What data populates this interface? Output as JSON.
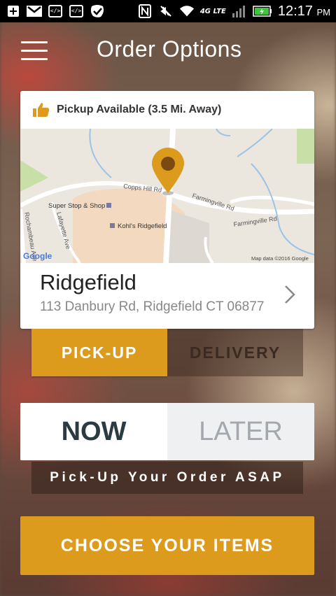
{
  "status_bar": {
    "time": "12:17",
    "ampm": "PM",
    "network": "4G LTE",
    "icons": [
      "plus-icon",
      "gmail-icon",
      "code-icon",
      "code-icon",
      "check-icon",
      "nfc-icon",
      "mute-icon",
      "wifi-icon",
      "signal-icon",
      "battery-icon"
    ]
  },
  "header": {
    "title": "Order Options"
  },
  "location_card": {
    "availability": "Pickup Available (3.5 Mi. Away)",
    "map": {
      "labels": {
        "road1": "Copps Hill Rd",
        "road2": "Farmingville Rd",
        "road3": "Farmingville Rd",
        "road4": "Lafayette Ave",
        "road5": "Rochambeau Ave",
        "poi1": "Super Stop & Shop",
        "poi2": "Kohl's Ridgefield",
        "google": "Google",
        "attribution": "Map data ©2016 Google"
      }
    },
    "name": "Ridgefield",
    "address": "113 Danbury Rd, Ridgefield CT 06877"
  },
  "order_type": {
    "pickup": "PICK-UP",
    "delivery": "DELIVERY",
    "selected": "pickup"
  },
  "timing": {
    "now": "NOW",
    "later": "LATER",
    "selected": "now"
  },
  "timing_caption": "Pick-Up Your Order ASAP",
  "cta": "CHOOSE YOUR ITEMS",
  "colors": {
    "accent": "#dc9b1d",
    "dark_text": "#2c3a42"
  }
}
